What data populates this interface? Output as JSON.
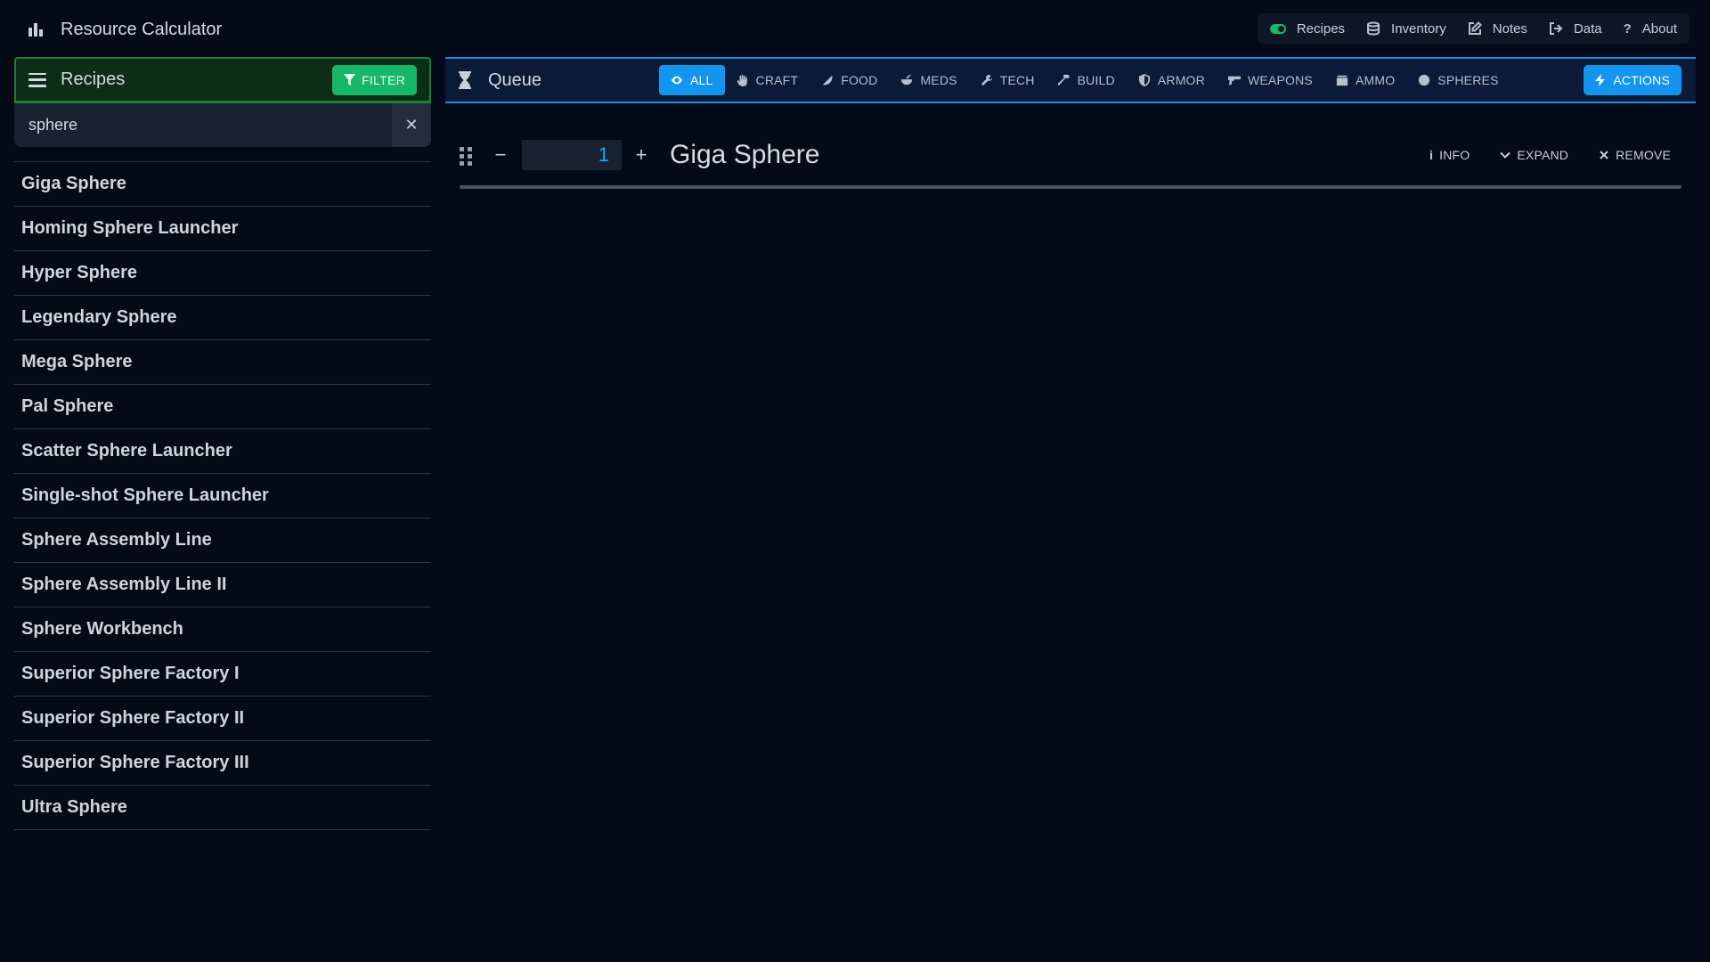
{
  "app": {
    "title": "Resource Calculator"
  },
  "top_nav": [
    {
      "label": "Recipes",
      "icon": "toggle-icon"
    },
    {
      "label": "Inventory",
      "icon": "database-icon"
    },
    {
      "label": "Notes",
      "icon": "edit-icon"
    },
    {
      "label": "Data",
      "icon": "export-icon"
    },
    {
      "label": "About",
      "icon": "question-icon"
    }
  ],
  "sidebar": {
    "title": "Recipes",
    "filter_label": "FILTER",
    "search": {
      "value": "sphere",
      "placeholder": ""
    },
    "items": [
      "Giga Sphere",
      "Homing Sphere Launcher",
      "Hyper Sphere",
      "Legendary Sphere",
      "Mega Sphere",
      "Pal Sphere",
      "Scatter Sphere Launcher",
      "Single-shot Sphere Launcher",
      "Sphere Assembly Line",
      "Sphere Assembly Line II",
      "Sphere Workbench",
      "Superior Sphere Factory I",
      "Superior Sphere Factory II",
      "Superior Sphere Factory III",
      "Ultra Sphere"
    ]
  },
  "queue": {
    "title": "Queue",
    "tabs": [
      {
        "label": "ALL",
        "active": true
      },
      {
        "label": "CRAFT"
      },
      {
        "label": "FOOD"
      },
      {
        "label": "MEDS"
      },
      {
        "label": "TECH"
      },
      {
        "label": "BUILD"
      },
      {
        "label": "ARMOR"
      },
      {
        "label": "WEAPONS"
      },
      {
        "label": "AMMO"
      },
      {
        "label": "SPHERES"
      }
    ],
    "actions_label": "ACTIONS",
    "entry": {
      "quantity": "1",
      "name": "Giga Sphere",
      "info_label": "INFO",
      "expand_label": "EXPAND",
      "remove_label": "REMOVE"
    }
  },
  "colors": {
    "background": "#050a17",
    "green_accent": "#17b768",
    "blue_accent": "#1394ee"
  }
}
